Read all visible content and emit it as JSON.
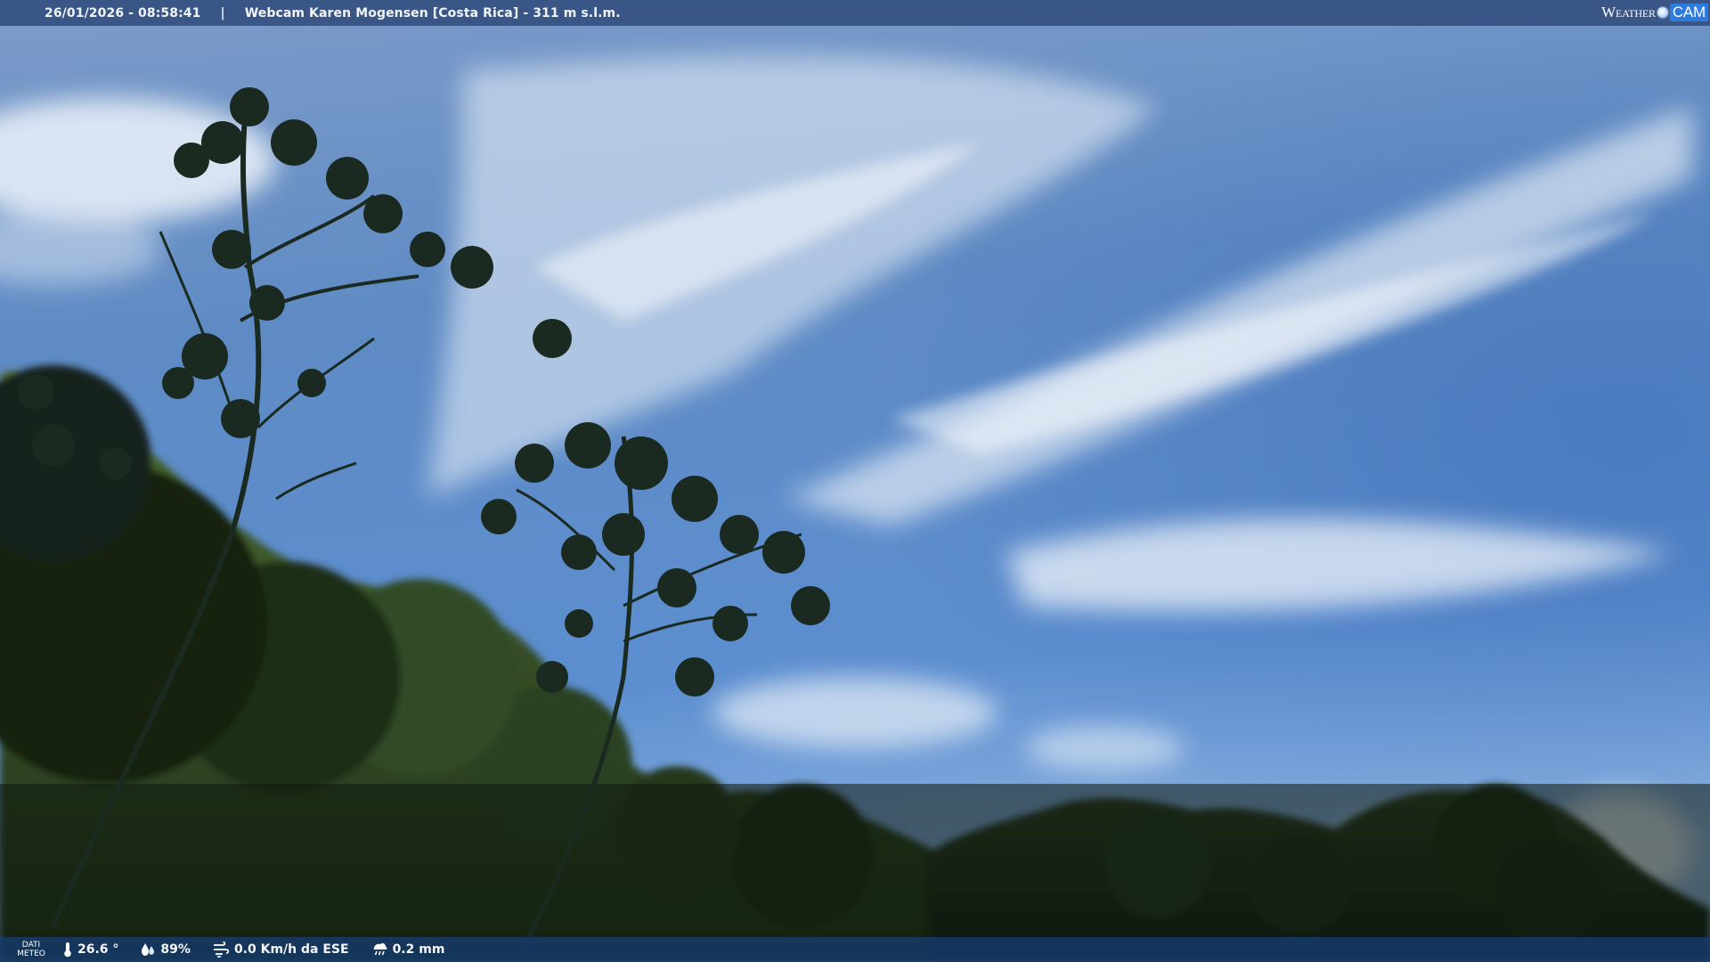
{
  "top_bar": {
    "datetime": "26/01/2026 - 08:58:41",
    "separator": "|",
    "camera_title": "Webcam Karen Mogensen [Costa Rica]  - 311 m s.l.m."
  },
  "logo": {
    "part1": "Weather",
    "part2": "CAM"
  },
  "bottom_bar": {
    "label_line1": "DATI",
    "label_line2": "METEO",
    "temperature": "26.6 °",
    "humidity": "89%",
    "wind": "0.0 Km/h da ESE",
    "rain": "0.2 mm"
  },
  "icons": {
    "temperature": "thermometer-icon",
    "humidity": "water-drops-icon",
    "wind": "wind-icon",
    "rain": "rain-icon"
  },
  "colors": {
    "top_bar": "#345080",
    "bottom_bar": "#163a6c",
    "sky_top": "#3f6fb0",
    "sky_bottom": "#6f9fd6",
    "foliage": "#1c2a1a"
  }
}
